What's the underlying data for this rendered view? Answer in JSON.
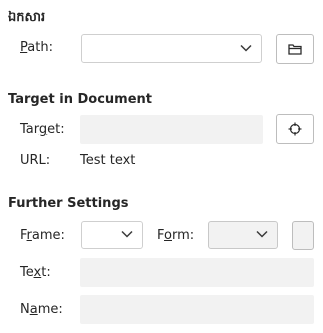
{
  "section_hyperlink": {
    "heading": "ឯកសារ"
  },
  "path": {
    "label_pre": "",
    "label_key": "P",
    "label_post": "ath:",
    "value": ""
  },
  "target_section": {
    "heading": "Target in Document"
  },
  "target": {
    "label_pre": "Tar",
    "label_key": "g",
    "label_post": "et:",
    "value": ""
  },
  "url": {
    "label": "URL:",
    "value": "Test text"
  },
  "further": {
    "heading": "Further Settings"
  },
  "frame": {
    "label_pre": "F",
    "label_key": "r",
    "label_post": "ame:",
    "value": ""
  },
  "form": {
    "label_pre": "F",
    "label_key": "o",
    "label_post": "rm:",
    "value": ""
  },
  "text": {
    "label_pre": "Te",
    "label_key": "x",
    "label_post": "t:",
    "value": ""
  },
  "name": {
    "label_pre": "N",
    "label_key": "a",
    "label_post": "me:",
    "value": ""
  },
  "icons": {
    "open_file": "folder-icon",
    "target_browse": "crosshair-target-icon",
    "dropdown": "chevron-down-icon"
  }
}
